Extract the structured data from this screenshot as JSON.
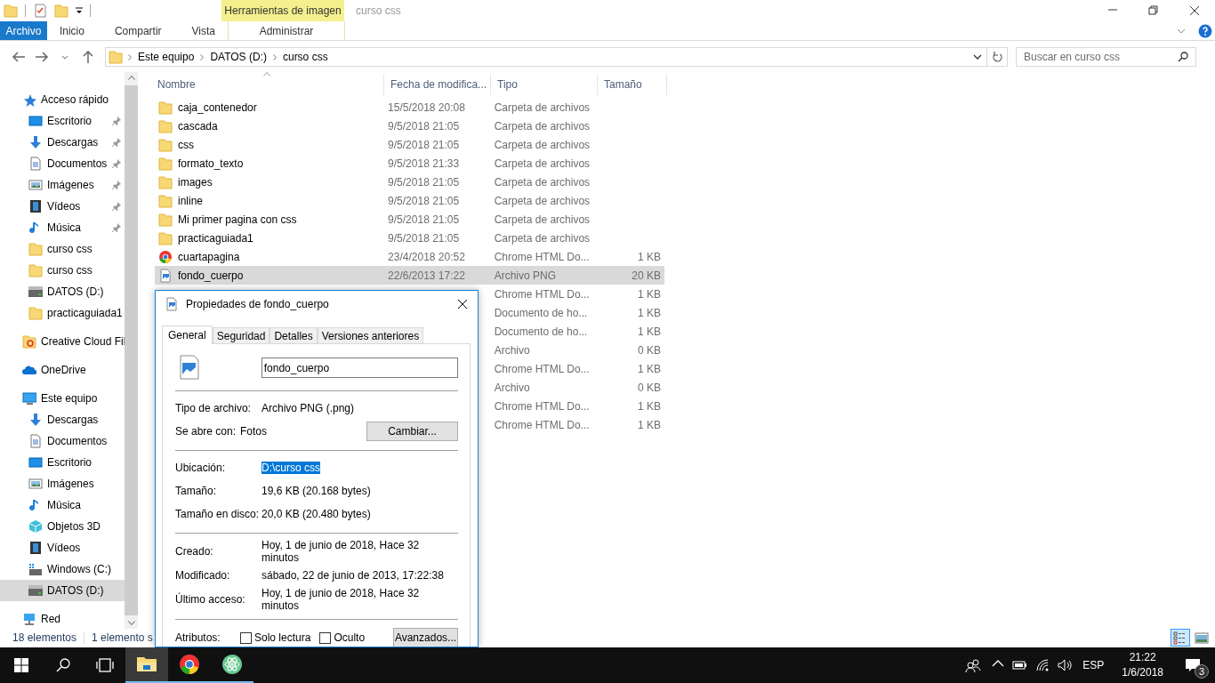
{
  "titlebar": {
    "contextual_group": "Herramientas de imagen",
    "title": "curso css"
  },
  "ribbon_tabs": [
    {
      "label": "Archivo",
      "kind": "file"
    },
    {
      "label": "Inicio",
      "kind": "tab"
    },
    {
      "label": "Compartir",
      "kind": "tab"
    },
    {
      "label": "Vista",
      "kind": "tab"
    },
    {
      "label": "Administrar",
      "kind": "contextual"
    }
  ],
  "breadcrumb": [
    "Este equipo",
    "DATOS (D:)",
    "curso css"
  ],
  "search": {
    "placeholder": "Buscar en curso css"
  },
  "sidebar": [
    {
      "label": "Acceso rápido",
      "kind": "star",
      "selected": false,
      "children": [
        {
          "label": "Escritorio",
          "kind": "desktop",
          "pinned": true,
          "selected": false
        },
        {
          "label": "Descargas",
          "kind": "download",
          "pinned": true,
          "selected": false
        },
        {
          "label": "Documentos",
          "kind": "document",
          "pinned": true,
          "selected": false
        },
        {
          "label": "Imágenes",
          "kind": "pictures",
          "pinned": true,
          "selected": false
        },
        {
          "label": "Vídeos",
          "kind": "videos",
          "pinned": true,
          "selected": false
        },
        {
          "label": "Música",
          "kind": "music",
          "pinned": true,
          "selected": false
        },
        {
          "label": "curso css",
          "kind": "folder",
          "pinned": false,
          "selected": false
        },
        {
          "label": "curso css",
          "kind": "folder",
          "pinned": false,
          "selected": false
        },
        {
          "label": "DATOS (D:)",
          "kind": "drive",
          "pinned": false,
          "selected": false
        },
        {
          "label": "practicaguiada1",
          "kind": "folder",
          "pinned": false,
          "selected": false
        }
      ]
    },
    {
      "label": "Creative Cloud Fil",
      "kind": "creative",
      "selected": false
    },
    {
      "label": "OneDrive",
      "kind": "cloud",
      "selected": false
    },
    {
      "label": "Este equipo",
      "kind": "pc",
      "selected": false,
      "children": [
        {
          "label": "Descargas",
          "kind": "download",
          "pinned": false,
          "selected": false
        },
        {
          "label": "Documentos",
          "kind": "document",
          "pinned": false,
          "selected": false
        },
        {
          "label": "Escritorio",
          "kind": "desktop",
          "pinned": false,
          "selected": false
        },
        {
          "label": "Imágenes",
          "kind": "pictures",
          "pinned": false,
          "selected": false
        },
        {
          "label": "Música",
          "kind": "music",
          "pinned": false,
          "selected": false
        },
        {
          "label": "Objetos 3D",
          "kind": "cube",
          "pinned": false,
          "selected": false
        },
        {
          "label": "Vídeos",
          "kind": "videos",
          "pinned": false,
          "selected": false
        },
        {
          "label": "Windows (C:)",
          "kind": "windrive",
          "pinned": false,
          "selected": false
        },
        {
          "label": "DATOS (D:)",
          "kind": "drive",
          "pinned": false,
          "selected": true
        }
      ]
    },
    {
      "label": "Red",
      "kind": "network",
      "selected": false
    }
  ],
  "columns": [
    "Nombre",
    "Fecha de modifica...",
    "Tipo",
    "Tamaño"
  ],
  "files": [
    {
      "name": "caja_contenedor",
      "date": "15/5/2018 20:08",
      "type": "Carpeta de archivos",
      "kind": "folder",
      "selected": false
    },
    {
      "name": "cascada",
      "date": "9/5/2018 21:05",
      "type": "Carpeta de archivos",
      "kind": "folder",
      "selected": false
    },
    {
      "name": "css",
      "date": "9/5/2018 21:05",
      "type": "Carpeta de archivos",
      "kind": "folder",
      "selected": false
    },
    {
      "name": "formato_texto",
      "date": "9/5/2018 21:33",
      "type": "Carpeta de archivos",
      "kind": "folder",
      "selected": false
    },
    {
      "name": "images",
      "date": "9/5/2018 21:05",
      "type": "Carpeta de archivos",
      "kind": "folder",
      "selected": false
    },
    {
      "name": "inline",
      "date": "9/5/2018 21:05",
      "type": "Carpeta de archivos",
      "kind": "folder",
      "selected": false
    },
    {
      "name": "Mi primer pagina con css",
      "date": "9/5/2018 21:05",
      "type": "Carpeta de archivos",
      "kind": "folder",
      "selected": false
    },
    {
      "name": "practicaguiada1",
      "date": "9/5/2018 21:05",
      "type": "Carpeta de archivos",
      "kind": "folder",
      "selected": false
    },
    {
      "name": "cuartapagina",
      "date": "23/4/2018 20:52",
      "type": "Chrome HTML Do...",
      "size": "1 KB",
      "kind": "chrome",
      "selected": false
    },
    {
      "name": "fondo_cuerpo",
      "date": "22/6/2013 17:22",
      "type": "Archivo PNG",
      "size": "20 KB",
      "kind": "image",
      "selected": true
    },
    {
      "type": "Chrome HTML Do...",
      "size": "1 KB",
      "selected": false
    },
    {
      "type": "Documento de ho...",
      "size": "1 KB",
      "selected": false
    },
    {
      "type": "Documento de ho...",
      "size": "1 KB",
      "selected": false
    },
    {
      "type": "Archivo",
      "size": "0 KB",
      "selected": false
    },
    {
      "type": "Chrome HTML Do...",
      "size": "1 KB",
      "selected": false
    },
    {
      "type": "Archivo",
      "size": "0 KB",
      "selected": false
    },
    {
      "type": "Chrome HTML Do...",
      "size": "1 KB",
      "selected": false
    },
    {
      "type": "Chrome HTML Do...",
      "size": "1 KB",
      "selected": false
    }
  ],
  "status_bar": [
    "18 elementos",
    "1 elemento s"
  ],
  "view_buttons": [
    {
      "kind": "details",
      "selected": true
    },
    {
      "kind": "large",
      "selected": false
    }
  ],
  "dialog": {
    "title": "Propiedades de fondo_cuerpo",
    "tabs": [
      {
        "label": "General",
        "selected": true
      },
      {
        "label": "Seguridad",
        "selected": false
      },
      {
        "label": "Detalles",
        "selected": false
      },
      {
        "label": "Versiones anteriores",
        "selected": false
      }
    ],
    "file_name": "fondo_cuerpo",
    "groups": [
      [
        {
          "label": "Tipo de archivo:",
          "value": "Archivo PNG (.png)",
          "kind": "text",
          "selected": false
        },
        {
          "label": "Se abre con:",
          "value": "Fotos",
          "button": "Cambiar...",
          "kind": "app",
          "selected": false
        }
      ],
      [
        {
          "label": "Ubicación:",
          "value": "D:\\curso css",
          "kind": "text",
          "selected": true
        },
        {
          "label": "Tamaño:",
          "value": "19,6 KB (20.168 bytes)",
          "kind": "text",
          "selected": false
        },
        {
          "label": "Tamaño en disco:",
          "value": "20,0 KB (20.480 bytes)",
          "kind": "text",
          "selected": false
        }
      ],
      [
        {
          "label": "Creado:",
          "value": "Hoy, 1 de junio de 2018, Hace 32 minutos",
          "kind": "text",
          "selected": false
        },
        {
          "label": "Modificado:",
          "value": "sábado, 22 de junio de 2013, 17:22:38",
          "kind": "text",
          "selected": false
        },
        {
          "label": "Último acceso:",
          "value": "Hoy, 1 de junio de 2018, Hace 32 minutos",
          "kind": "text",
          "selected": false
        }
      ]
    ],
    "attributes": {
      "label": "Atributos:",
      "checkboxes": [
        {
          "label": "Solo lectura",
          "checked": false
        },
        {
          "label": "Oculto",
          "checked": false
        }
      ],
      "button": "Avanzados..."
    }
  },
  "taskbar": {
    "apps": [
      {
        "kind": "explorer",
        "active": true
      },
      {
        "kind": "chrome",
        "active": false
      },
      {
        "kind": "atom",
        "active": false
      }
    ],
    "language": "ESP",
    "time": "21:22",
    "date": "1/6/2018",
    "notifications": "3"
  }
}
